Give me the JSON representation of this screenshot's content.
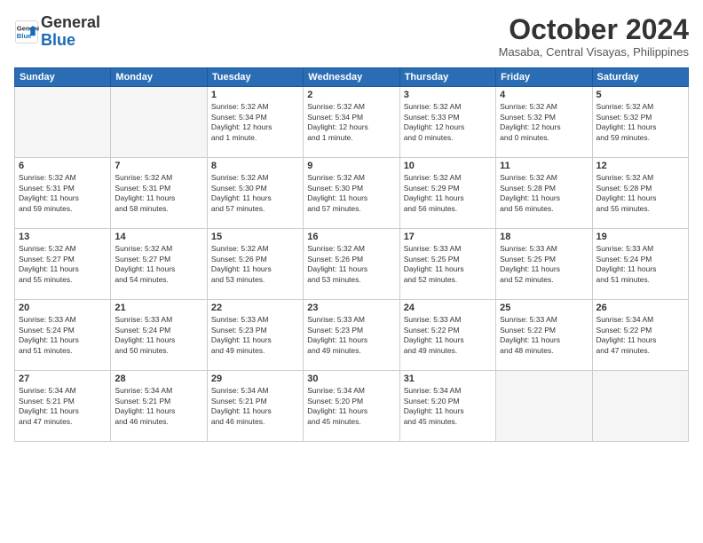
{
  "header": {
    "logo_line1": "General",
    "logo_line2": "Blue",
    "month": "October 2024",
    "location": "Masaba, Central Visayas, Philippines"
  },
  "weekdays": [
    "Sunday",
    "Monday",
    "Tuesday",
    "Wednesday",
    "Thursday",
    "Friday",
    "Saturday"
  ],
  "weeks": [
    [
      {
        "day": "",
        "info": ""
      },
      {
        "day": "",
        "info": ""
      },
      {
        "day": "1",
        "info": "Sunrise: 5:32 AM\nSunset: 5:34 PM\nDaylight: 12 hours\nand 1 minute."
      },
      {
        "day": "2",
        "info": "Sunrise: 5:32 AM\nSunset: 5:34 PM\nDaylight: 12 hours\nand 1 minute."
      },
      {
        "day": "3",
        "info": "Sunrise: 5:32 AM\nSunset: 5:33 PM\nDaylight: 12 hours\nand 0 minutes."
      },
      {
        "day": "4",
        "info": "Sunrise: 5:32 AM\nSunset: 5:32 PM\nDaylight: 12 hours\nand 0 minutes."
      },
      {
        "day": "5",
        "info": "Sunrise: 5:32 AM\nSunset: 5:32 PM\nDaylight: 11 hours\nand 59 minutes."
      }
    ],
    [
      {
        "day": "6",
        "info": "Sunrise: 5:32 AM\nSunset: 5:31 PM\nDaylight: 11 hours\nand 59 minutes."
      },
      {
        "day": "7",
        "info": "Sunrise: 5:32 AM\nSunset: 5:31 PM\nDaylight: 11 hours\nand 58 minutes."
      },
      {
        "day": "8",
        "info": "Sunrise: 5:32 AM\nSunset: 5:30 PM\nDaylight: 11 hours\nand 57 minutes."
      },
      {
        "day": "9",
        "info": "Sunrise: 5:32 AM\nSunset: 5:30 PM\nDaylight: 11 hours\nand 57 minutes."
      },
      {
        "day": "10",
        "info": "Sunrise: 5:32 AM\nSunset: 5:29 PM\nDaylight: 11 hours\nand 56 minutes."
      },
      {
        "day": "11",
        "info": "Sunrise: 5:32 AM\nSunset: 5:28 PM\nDaylight: 11 hours\nand 56 minutes."
      },
      {
        "day": "12",
        "info": "Sunrise: 5:32 AM\nSunset: 5:28 PM\nDaylight: 11 hours\nand 55 minutes."
      }
    ],
    [
      {
        "day": "13",
        "info": "Sunrise: 5:32 AM\nSunset: 5:27 PM\nDaylight: 11 hours\nand 55 minutes."
      },
      {
        "day": "14",
        "info": "Sunrise: 5:32 AM\nSunset: 5:27 PM\nDaylight: 11 hours\nand 54 minutes."
      },
      {
        "day": "15",
        "info": "Sunrise: 5:32 AM\nSunset: 5:26 PM\nDaylight: 11 hours\nand 53 minutes."
      },
      {
        "day": "16",
        "info": "Sunrise: 5:32 AM\nSunset: 5:26 PM\nDaylight: 11 hours\nand 53 minutes."
      },
      {
        "day": "17",
        "info": "Sunrise: 5:33 AM\nSunset: 5:25 PM\nDaylight: 11 hours\nand 52 minutes."
      },
      {
        "day": "18",
        "info": "Sunrise: 5:33 AM\nSunset: 5:25 PM\nDaylight: 11 hours\nand 52 minutes."
      },
      {
        "day": "19",
        "info": "Sunrise: 5:33 AM\nSunset: 5:24 PM\nDaylight: 11 hours\nand 51 minutes."
      }
    ],
    [
      {
        "day": "20",
        "info": "Sunrise: 5:33 AM\nSunset: 5:24 PM\nDaylight: 11 hours\nand 51 minutes."
      },
      {
        "day": "21",
        "info": "Sunrise: 5:33 AM\nSunset: 5:24 PM\nDaylight: 11 hours\nand 50 minutes."
      },
      {
        "day": "22",
        "info": "Sunrise: 5:33 AM\nSunset: 5:23 PM\nDaylight: 11 hours\nand 49 minutes."
      },
      {
        "day": "23",
        "info": "Sunrise: 5:33 AM\nSunset: 5:23 PM\nDaylight: 11 hours\nand 49 minutes."
      },
      {
        "day": "24",
        "info": "Sunrise: 5:33 AM\nSunset: 5:22 PM\nDaylight: 11 hours\nand 49 minutes."
      },
      {
        "day": "25",
        "info": "Sunrise: 5:33 AM\nSunset: 5:22 PM\nDaylight: 11 hours\nand 48 minutes."
      },
      {
        "day": "26",
        "info": "Sunrise: 5:34 AM\nSunset: 5:22 PM\nDaylight: 11 hours\nand 47 minutes."
      }
    ],
    [
      {
        "day": "27",
        "info": "Sunrise: 5:34 AM\nSunset: 5:21 PM\nDaylight: 11 hours\nand 47 minutes."
      },
      {
        "day": "28",
        "info": "Sunrise: 5:34 AM\nSunset: 5:21 PM\nDaylight: 11 hours\nand 46 minutes."
      },
      {
        "day": "29",
        "info": "Sunrise: 5:34 AM\nSunset: 5:21 PM\nDaylight: 11 hours\nand 46 minutes."
      },
      {
        "day": "30",
        "info": "Sunrise: 5:34 AM\nSunset: 5:20 PM\nDaylight: 11 hours\nand 45 minutes."
      },
      {
        "day": "31",
        "info": "Sunrise: 5:34 AM\nSunset: 5:20 PM\nDaylight: 11 hours\nand 45 minutes."
      },
      {
        "day": "",
        "info": ""
      },
      {
        "day": "",
        "info": ""
      }
    ]
  ]
}
